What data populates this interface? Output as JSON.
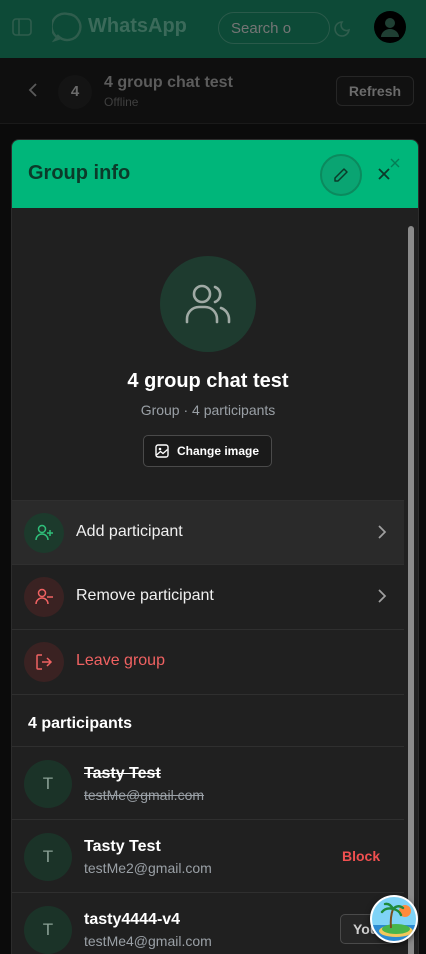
{
  "appbar": {
    "brand": "WhatsApp",
    "search_placeholder": "Search o",
    "icons": [
      "sidebar-toggle-icon",
      "whatsapp-logo-icon",
      "moon-icon",
      "user-avatar-icon"
    ]
  },
  "chat_header": {
    "avatar_number": "4",
    "title": "4 group chat test",
    "status": "Offline",
    "refresh_label": "Refresh"
  },
  "modal": {
    "title": "Group info",
    "group_name": "4 group chat test",
    "group_sub": "Group · 4 participants",
    "change_image_label": "Change image",
    "actions": [
      {
        "label": "Add participant",
        "icon": "user-plus-icon"
      },
      {
        "label": "Remove participant",
        "icon": "user-minus-icon"
      },
      {
        "label": "Leave group",
        "icon": "logout-icon"
      }
    ],
    "participants_title": "4 participants",
    "participants": [
      {
        "initial": "T",
        "name": "Tasty Test",
        "email": "testMe@gmail.com",
        "blocked": true
      },
      {
        "initial": "T",
        "name": "Tasty Test",
        "email": "testMe2@gmail.com",
        "action": "Block"
      },
      {
        "initial": "T",
        "name": "tasty4444-v4",
        "email": "testMe4@gmail.com",
        "action": "You"
      }
    ]
  },
  "colors": {
    "accent": "#00b67a",
    "danger": "#f06262",
    "modal_bg": "#202020"
  }
}
